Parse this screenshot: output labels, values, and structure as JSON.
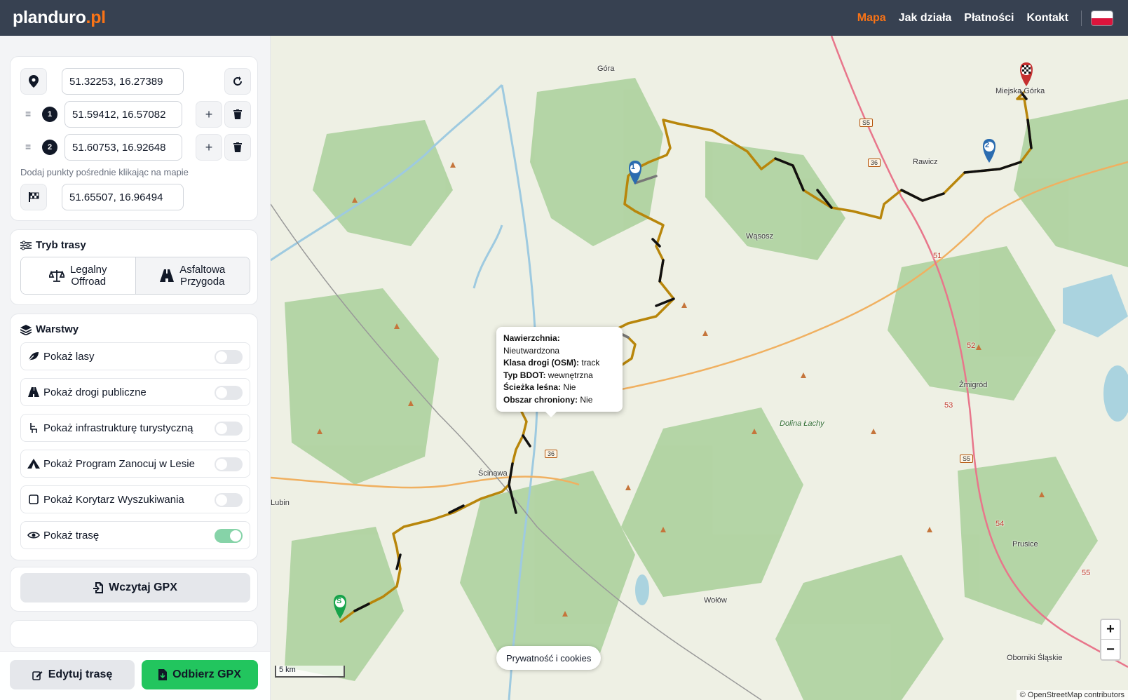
{
  "brand": {
    "name": "planduro",
    "tld": ".pl"
  },
  "nav": {
    "items": [
      "Mapa",
      "Jak działa",
      "Płatności",
      "Kontakt"
    ],
    "active": "Mapa",
    "language_flag": "pl-flag-icon"
  },
  "route": {
    "start": "51.32253, 16.27389",
    "waypoints": [
      {
        "num": "1",
        "value": "51.59412, 16.57082"
      },
      {
        "num": "2",
        "value": "51.60753, 16.92648"
      }
    ],
    "hint": "Dodaj punkty pośrednie klikając na mapie",
    "end": "51.65507, 16.96494"
  },
  "mode": {
    "title": "Tryb trasy",
    "options": [
      {
        "line1": "Legalny",
        "line2": "Offroad"
      },
      {
        "line1": "Asfaltowa",
        "line2": "Przygoda"
      }
    ]
  },
  "layers": {
    "title": "Warstwy",
    "items": [
      {
        "label": "Pokaż lasy",
        "on": false,
        "icon": "leaf-icon"
      },
      {
        "label": "Pokaż drogi publiczne",
        "on": false,
        "icon": "car-icon"
      },
      {
        "label": "Pokaż infrastrukturę turystyczną",
        "on": false,
        "icon": "bench-icon"
      },
      {
        "label": "Pokaż Program Zanocuj w Lesie",
        "on": false,
        "icon": "tent-icon"
      },
      {
        "label": "Pokaż Korytarz Wyszukiwania",
        "on": false,
        "icon": "square-icon"
      },
      {
        "label": "Pokaż trasę",
        "on": true,
        "icon": "eye-icon"
      }
    ]
  },
  "gpx": {
    "load": "Wczytaj GPX",
    "edit": "Edytuj trasę",
    "get": "Odbierz GPX"
  },
  "map": {
    "popup": [
      {
        "key": "Nawierzchnia:",
        "val": "Nieutwardzona"
      },
      {
        "key": "Klasa drogi (OSM):",
        "val": "track"
      },
      {
        "key": "Typ BDOT:",
        "val": "wewnętrzna"
      },
      {
        "key": "Ścieżka leśna:",
        "val": "Nie"
      },
      {
        "key": "Obszar chroniony:",
        "val": "Nie"
      }
    ],
    "towns": [
      "Góra",
      "Miejska Górka",
      "Rawicz",
      "Wąsosz",
      "Żmigród",
      "Ścinawa",
      "Wołów",
      "Prusice",
      "Oborniki Śląskie",
      "Dolina Łachy",
      "Lubin"
    ],
    "road_shields": [
      "S5",
      "36",
      "36",
      "S5",
      "51",
      "52",
      "53",
      "54",
      "55"
    ],
    "markers": {
      "start": "S",
      "wp1": "1",
      "wp2": "2"
    },
    "cookies": "Prywatność i cookies",
    "scale": "5 km",
    "attribution": "© OpenStreetMap contributors",
    "zoom_in": "+",
    "zoom_out": "−"
  },
  "colors": {
    "accent": "#f97316",
    "topbar": "#374151",
    "route": "#b8860b",
    "route_paved": "#111111",
    "download": "#22c55e"
  }
}
